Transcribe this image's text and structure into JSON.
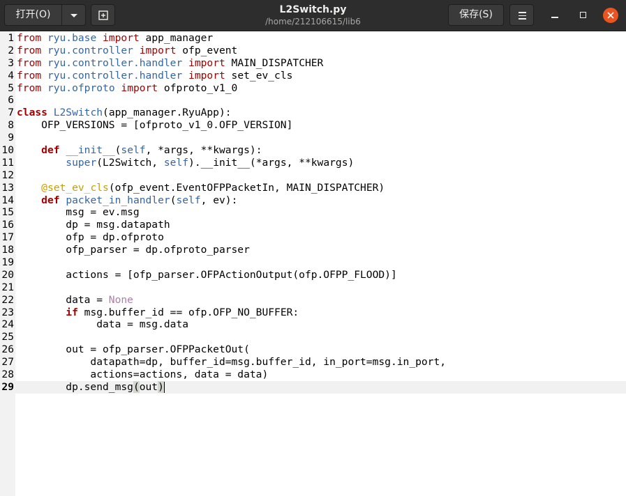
{
  "header": {
    "open_label": "打开(O)",
    "title": "L2Switch.py",
    "subtitle": "/home/212106615/lib6",
    "save_label": "保存(S)",
    "icons": {
      "open_menu": "chevron-down-icon",
      "new_tab": "new-tab-icon",
      "menu": "hamburger-menu-icon",
      "minimize": "minimize-icon",
      "maximize": "maximize-icon",
      "close": "close-icon"
    }
  },
  "editor": {
    "current_line": 29,
    "lines": [
      {
        "n": "1",
        "segs": [
          [
            "from",
            "kw2"
          ],
          [
            " ",
            ""
          ],
          [
            "ryu.base",
            "mod"
          ],
          [
            " ",
            ""
          ],
          [
            "import",
            "kw2"
          ],
          [
            " app_manager",
            ""
          ]
        ]
      },
      {
        "n": "2",
        "segs": [
          [
            "from",
            "kw2"
          ],
          [
            " ",
            ""
          ],
          [
            "ryu.controller",
            "mod"
          ],
          [
            " ",
            ""
          ],
          [
            "import",
            "kw2"
          ],
          [
            " ofp_event",
            ""
          ]
        ]
      },
      {
        "n": "3",
        "segs": [
          [
            "from",
            "kw2"
          ],
          [
            " ",
            ""
          ],
          [
            "ryu.controller.handler",
            "mod"
          ],
          [
            " ",
            ""
          ],
          [
            "import",
            "kw2"
          ],
          [
            " MAIN_DISPATCHER",
            ""
          ]
        ]
      },
      {
        "n": "4",
        "segs": [
          [
            "from",
            "kw2"
          ],
          [
            " ",
            ""
          ],
          [
            "ryu.controller.handler",
            "mod"
          ],
          [
            " ",
            ""
          ],
          [
            "import",
            "kw2"
          ],
          [
            " set_ev_cls",
            ""
          ]
        ]
      },
      {
        "n": "5",
        "segs": [
          [
            "from",
            "kw2"
          ],
          [
            " ",
            ""
          ],
          [
            "ryu.ofproto",
            "mod"
          ],
          [
            " ",
            ""
          ],
          [
            "import",
            "kw2"
          ],
          [
            " ofproto_v1_0",
            ""
          ]
        ]
      },
      {
        "n": "6",
        "segs": []
      },
      {
        "n": "7",
        "segs": [
          [
            "class",
            "kw"
          ],
          [
            " ",
            ""
          ],
          [
            "L2Switch",
            "fn"
          ],
          [
            "(app_manager.RyuApp):",
            ""
          ]
        ]
      },
      {
        "n": "8",
        "segs": [
          [
            "    OFP_VERSIONS = [ofproto_v1_0.OFP_VERSION]",
            ""
          ]
        ]
      },
      {
        "n": "9",
        "segs": []
      },
      {
        "n": "10",
        "segs": [
          [
            "    ",
            ""
          ],
          [
            "def",
            "kw"
          ],
          [
            " ",
            ""
          ],
          [
            "__init__",
            "fn"
          ],
          [
            "(",
            ""
          ],
          [
            "self",
            "fn"
          ],
          [
            ", *args, **kwargs):",
            ""
          ]
        ]
      },
      {
        "n": "11",
        "segs": [
          [
            "        ",
            ""
          ],
          [
            "super",
            "fn"
          ],
          [
            "(L2Switch, ",
            ""
          ],
          [
            "self",
            "fn"
          ],
          [
            ").__init__(*args, **kwargs)",
            ""
          ]
        ]
      },
      {
        "n": "12",
        "segs": []
      },
      {
        "n": "13",
        "segs": [
          [
            "    ",
            ""
          ],
          [
            "@set_ev_cls",
            "deco"
          ],
          [
            "(ofp_event.EventOFPPacketIn, MAIN_DISPATCHER)",
            ""
          ]
        ]
      },
      {
        "n": "14",
        "segs": [
          [
            "    ",
            ""
          ],
          [
            "def",
            "kw"
          ],
          [
            " ",
            ""
          ],
          [
            "packet_in_handler",
            "fn"
          ],
          [
            "(",
            ""
          ],
          [
            "self",
            "fn"
          ],
          [
            ", ev):",
            ""
          ]
        ]
      },
      {
        "n": "15",
        "segs": [
          [
            "        msg = ev.msg",
            ""
          ]
        ]
      },
      {
        "n": "16",
        "segs": [
          [
            "        dp = msg.datapath",
            ""
          ]
        ]
      },
      {
        "n": "17",
        "segs": [
          [
            "        ofp = dp.ofproto",
            ""
          ]
        ]
      },
      {
        "n": "18",
        "segs": [
          [
            "        ofp_parser = dp.ofproto_parser",
            ""
          ]
        ]
      },
      {
        "n": "19",
        "segs": []
      },
      {
        "n": "20",
        "segs": [
          [
            "        actions = [ofp_parser.OFPActionOutput(ofp.OFPP_FLOOD)]",
            ""
          ]
        ]
      },
      {
        "n": "21",
        "segs": []
      },
      {
        "n": "22",
        "segs": [
          [
            "        data = ",
            ""
          ],
          [
            "None",
            "const"
          ]
        ]
      },
      {
        "n": "23",
        "segs": [
          [
            "        ",
            ""
          ],
          [
            "if",
            "kw"
          ],
          [
            " msg.buffer_id == ofp.OFP_NO_BUFFER:",
            ""
          ]
        ]
      },
      {
        "n": "24",
        "segs": [
          [
            "             data = msg.data",
            ""
          ]
        ]
      },
      {
        "n": "25",
        "segs": []
      },
      {
        "n": "26",
        "segs": [
          [
            "        out = ofp_parser.OFPPacketOut(",
            ""
          ]
        ]
      },
      {
        "n": "27",
        "segs": [
          [
            "            datapath=dp, buffer_id=msg.buffer_id, in_port=msg.in_port,",
            ""
          ]
        ]
      },
      {
        "n": "28",
        "segs": [
          [
            "            actions=actions, data = data)",
            ""
          ]
        ]
      },
      {
        "n": "29",
        "segs": [
          [
            "        dp.send_msg",
            ""
          ],
          [
            "(",
            "brk"
          ],
          [
            "out",
            ""
          ],
          [
            ")",
            "brk"
          ]
        ]
      }
    ]
  }
}
